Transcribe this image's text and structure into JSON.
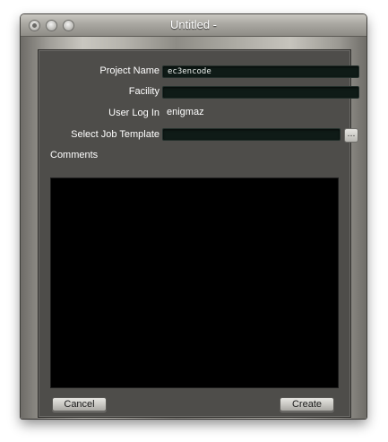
{
  "window": {
    "title": "Untitled -"
  },
  "form": {
    "project_name_label": "Project Name",
    "project_name_value": "ec3encode",
    "facility_label": "Facility",
    "facility_value": "",
    "user_login_label": "User Log In",
    "user_login_value": "enigmaz",
    "job_template_label": "Select Job Template",
    "job_template_value": "",
    "browse_label": "…",
    "comments_label": "Comments",
    "comments_value": ""
  },
  "buttons": {
    "cancel": "Cancel",
    "create": "Create"
  }
}
